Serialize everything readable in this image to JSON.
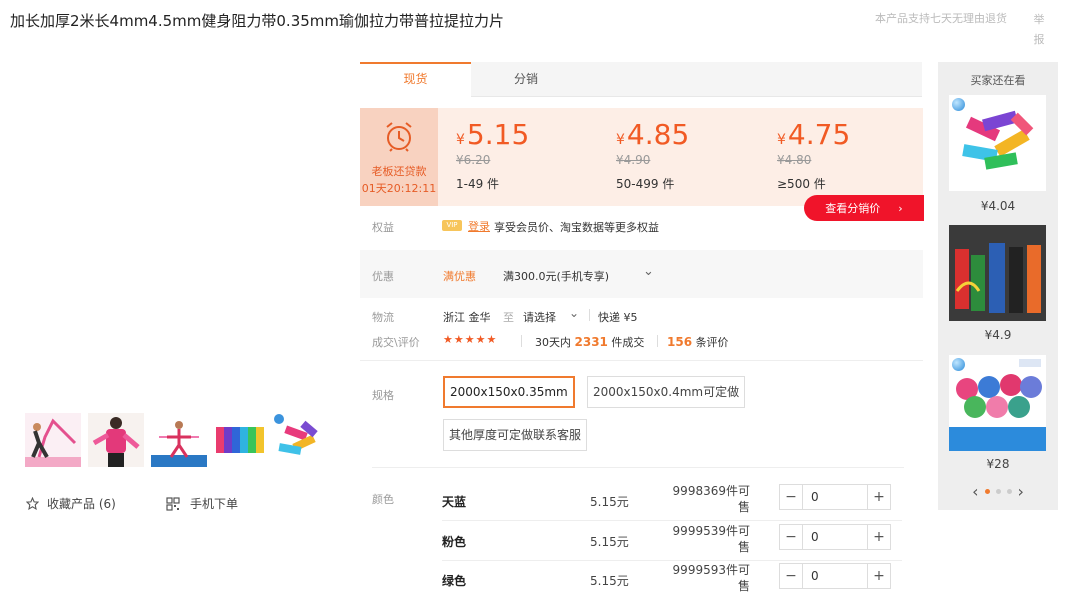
{
  "product": {
    "title": "加长加厚2米长4mm4.5mm健身阻力带0.35mm瑜伽拉力带普拉提拉力片",
    "return_policy": "本产品支持七天无理由退货",
    "report": "举报"
  },
  "gallery": {
    "favorite_label": "收藏产品 (6)",
    "mobile_order_label": "手机下单"
  },
  "tabs": [
    {
      "label": "现货"
    },
    {
      "label": "分销"
    }
  ],
  "promo": {
    "label": "老板还贷款",
    "countdown": "01天20:12:11",
    "tiers": [
      {
        "currency": "¥",
        "price": "5.15",
        "orig": "¥6.20",
        "range": "1-49 件"
      },
      {
        "currency": "¥",
        "price": "4.85",
        "orig": "¥4.90",
        "range": "50-499 件"
      },
      {
        "currency": "¥",
        "price": "4.75",
        "orig": "¥4.80",
        "range": "≥500 件"
      }
    ],
    "view_dist_price": "查看分销价",
    "view_arrow": "›"
  },
  "benefit": {
    "label": "权益",
    "badge": "VIP",
    "login": "登录",
    "text": "享受会员价、淘宝数据等更多权益"
  },
  "coupon": {
    "label": "优惠",
    "tag": "满优惠",
    "text": "满300.0元(手机专享)",
    "chevron": "⌄"
  },
  "logistics": {
    "label": "物流",
    "from": "浙江 金华",
    "to": "至",
    "select": "请选择",
    "express": "快递 ¥5"
  },
  "reviews": {
    "label": "成交\\评价",
    "stars": "★★★★★",
    "sales_prefix": "30天内",
    "sales_count": "2331",
    "sales_suffix": "件成交",
    "review_count": "156",
    "review_suffix": "条评价"
  },
  "spec": {
    "label": "规格",
    "options": [
      "2000x150x0.35mm",
      "2000x150x0.4mm可定做",
      "其他厚度可定做联系客服"
    ],
    "selected_index": 0
  },
  "colors": {
    "label": "颜色",
    "rows": [
      {
        "name": "天蓝",
        "price": "5.15元",
        "stock": "9998369件可售",
        "qty": "0"
      },
      {
        "name": "粉色",
        "price": "5.15元",
        "stock": "9999539件可售",
        "qty": "0"
      },
      {
        "name": "绿色",
        "price": "5.15元",
        "stock": "9999593件可售",
        "qty": "0"
      }
    ],
    "minus": "−",
    "plus": "+"
  },
  "also_viewed": {
    "title": "买家还在看",
    "items": [
      {
        "price": "¥4.04"
      },
      {
        "price": "¥4.9"
      },
      {
        "price": "¥28"
      }
    ],
    "prev": "‹",
    "next": "›"
  }
}
